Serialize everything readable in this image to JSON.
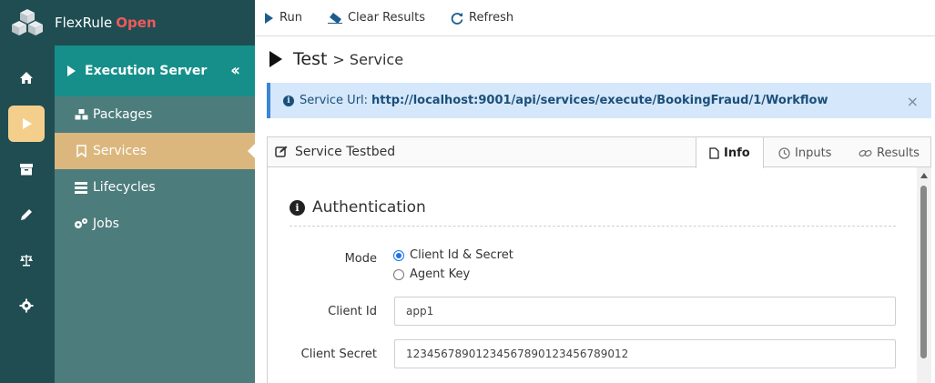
{
  "brand": {
    "name": "FlexRule",
    "edition": "Open"
  },
  "rail": {
    "items": [
      {
        "name": "home-icon"
      },
      {
        "name": "play-icon",
        "active": true
      },
      {
        "name": "archive-icon"
      },
      {
        "name": "pencil-icon"
      },
      {
        "name": "scale-icon"
      },
      {
        "name": "gear-icon"
      }
    ]
  },
  "subnav": {
    "header": "Execution Server",
    "items": [
      {
        "label": "Packages",
        "icon": "cubes-icon"
      },
      {
        "label": "Services",
        "icon": "bookmark-icon",
        "active": true
      },
      {
        "label": "Lifecycles",
        "icon": "list-icon"
      },
      {
        "label": "Jobs",
        "icon": "gears-icon"
      }
    ]
  },
  "toolbar": {
    "run": "Run",
    "clear": "Clear Results",
    "refresh": "Refresh"
  },
  "page": {
    "title": "Test",
    "crumb": "> Service"
  },
  "alert": {
    "label": "Service Url:",
    "url": "http://localhost:9001/api/services/execute/BookingFraud/1/Workflow",
    "close": "×"
  },
  "panel": {
    "title": "Service Testbed",
    "tabs": [
      {
        "label": "Info",
        "active": true
      },
      {
        "label": "Inputs"
      },
      {
        "label": "Results"
      }
    ]
  },
  "auth": {
    "heading": "Authentication",
    "mode_label": "Mode",
    "mode_options": [
      {
        "label": "Client Id & Secret",
        "selected": true
      },
      {
        "label": "Agent Key",
        "selected": false
      }
    ],
    "client_id_label": "Client Id",
    "client_id_value": "app1",
    "client_secret_label": "Client Secret",
    "client_secret_value": "12345678901234567890123456789012"
  },
  "colors": {
    "rail": "#1f4d52",
    "subnav": "#4d7c7c",
    "subnav_head": "#168f8a",
    "active_item": "#dbb77d",
    "rail_active": "#f4cf8c",
    "brand_accent": "#f05a5a",
    "alert_bg": "#d5e7fa"
  }
}
